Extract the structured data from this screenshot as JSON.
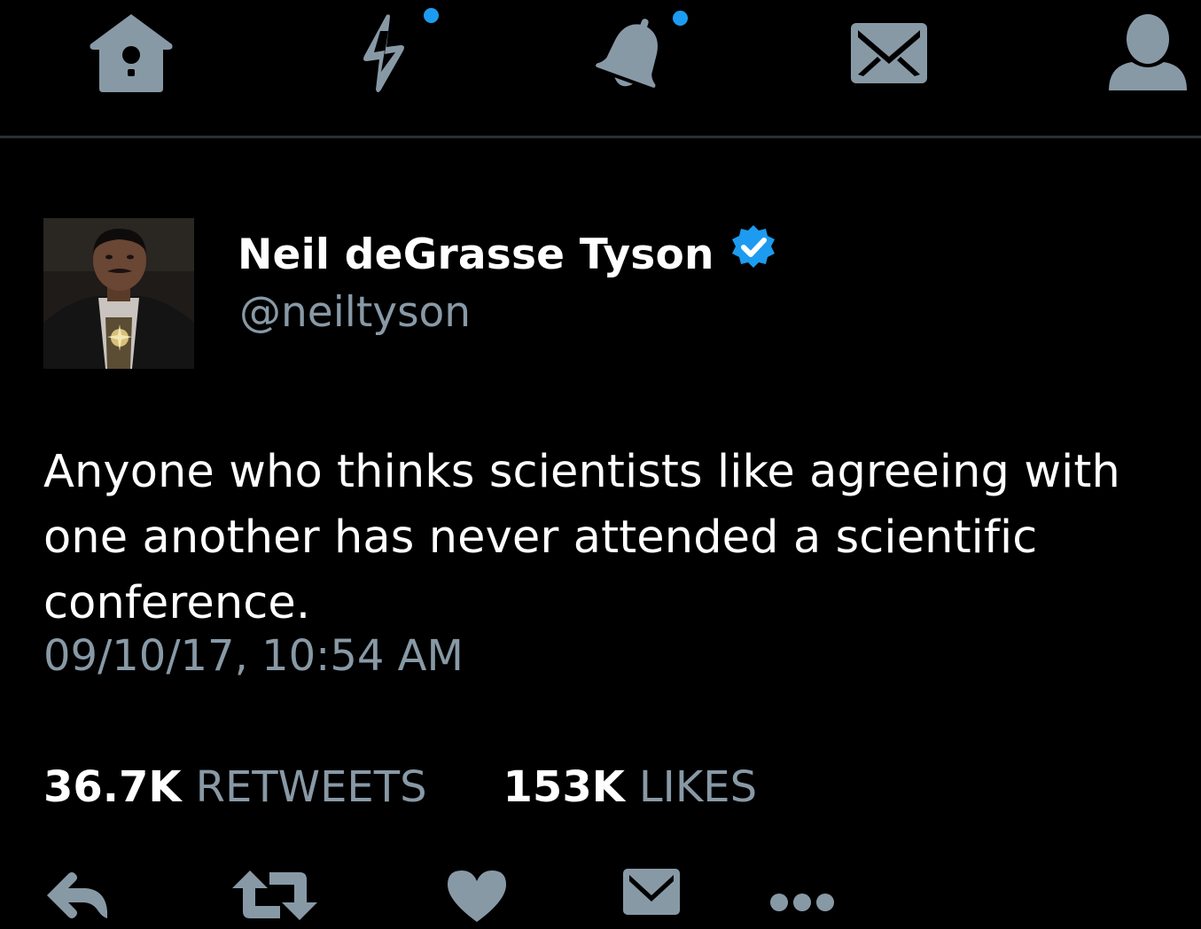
{
  "nav": {
    "items": [
      {
        "name": "home",
        "icon": "birdhouse-icon",
        "has_dot": false
      },
      {
        "name": "moments",
        "icon": "lightning-icon",
        "has_dot": true
      },
      {
        "name": "notifications",
        "icon": "bell-icon",
        "has_dot": true
      },
      {
        "name": "messages",
        "icon": "envelope-icon",
        "has_dot": false
      },
      {
        "name": "me",
        "icon": "person-icon",
        "has_dot": false
      }
    ],
    "icon_color": "#8899a6",
    "dot_color": "#1d9bf0"
  },
  "tweet": {
    "author": {
      "display_name": "Neil deGrasse Tyson",
      "handle": "@neiltyson",
      "verified": true,
      "verified_color": "#1d9bf0"
    },
    "text": "Anyone who thinks scientists like agreeing with one another has never attended a scientific conference.",
    "timestamp": "09/10/17, 10:54 AM",
    "stats": {
      "retweets_count": "36.7K",
      "retweets_label": "RETWEETS",
      "likes_count": "153K",
      "likes_label": "LIKES"
    },
    "actions": [
      {
        "name": "reply",
        "icon": "reply-icon"
      },
      {
        "name": "retweet",
        "icon": "retweet-icon"
      },
      {
        "name": "like",
        "icon": "heart-icon"
      },
      {
        "name": "direct-message",
        "icon": "envelope-icon"
      },
      {
        "name": "more",
        "icon": "more-dots-icon"
      }
    ]
  },
  "colors": {
    "background": "#000000",
    "primary_text": "#ffffff",
    "secondary_text": "#8899a6",
    "divider": "#2b2f33"
  }
}
